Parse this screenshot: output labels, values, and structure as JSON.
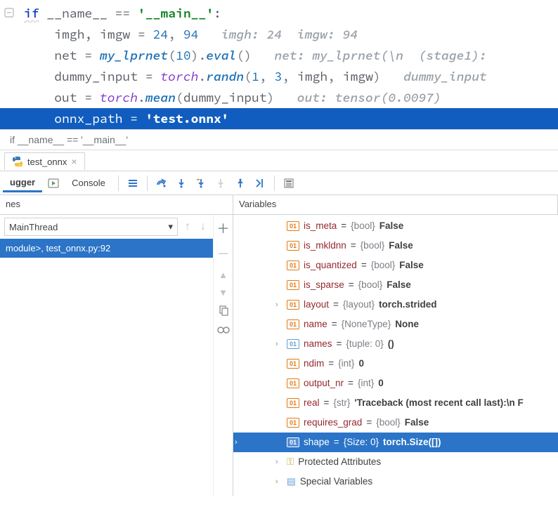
{
  "editor": {
    "lines": {
      "l1_kw": "if",
      "l1_rest": " __name__ == ",
      "l1_str": "'__main__'",
      "l1_colon": ":",
      "l2_vars": "imgh, imgw",
      "l2_eq": " = ",
      "l2_n1": "24",
      "l2_c": ", ",
      "l2_n2": "94",
      "l2_hint": "   imgh: 24  imgw: 94",
      "l3_v": "net",
      "l3_eq": " = ",
      "l3_fn1": "my_lprnet",
      "l3_p1": "(",
      "l3_n": "10",
      "l3_p2": ").",
      "l3_fn2": "eval",
      "l3_p3": "()",
      "l3_hint": "   net: my_lprnet(\\n  (stage1):",
      "l4_v": "dummy_input",
      "l4_eq": " = ",
      "l4_obj": "torch",
      "l4_dot": ".",
      "l4_fn": "randn",
      "l4_p1": "(",
      "l4_n1": "1",
      "l4_c1": ", ",
      "l4_n2": "3",
      "l4_c2": ", ",
      "l4_a1": "imgh",
      "l4_c3": ", ",
      "l4_a2": "imgw",
      "l4_p2": ")",
      "l4_hint": "   dummy_input",
      "l5_v": "out",
      "l5_eq": " = ",
      "l5_obj": "torch",
      "l5_dot": ".",
      "l5_fn": "mean",
      "l5_p1": "(",
      "l5_a": "dummy_input",
      "l5_p2": ")",
      "l5_hint": "   out: tensor(0.0097)",
      "l6_v": "onnx_path",
      "l6_eq": " = ",
      "l6_str": "'test.onnx'"
    }
  },
  "breadcrumb": "if __name__ == '__main__'",
  "tab": {
    "title": "test_onnx",
    "close": "×"
  },
  "toolbar": {
    "debugger": "ugger",
    "console": "Console"
  },
  "panes": {
    "left": "nes",
    "right": "Variables"
  },
  "thread": {
    "selected": "MainThread"
  },
  "frame": "module>, test_onnx.py:92",
  "tree_badge": "01",
  "vars": [
    {
      "name": "is_meta",
      "type": "{bool}",
      "val": "False"
    },
    {
      "name": "is_mkldnn",
      "type": "{bool}",
      "val": "False"
    },
    {
      "name": "is_quantized",
      "type": "{bool}",
      "val": "False"
    },
    {
      "name": "is_sparse",
      "type": "{bool}",
      "val": "False"
    },
    {
      "name": "layout",
      "type": "{layout}",
      "val": "torch.strided",
      "exp": true,
      "icon": "eq"
    },
    {
      "name": "name",
      "type": "{NoneType}",
      "val": "None"
    },
    {
      "name": "names",
      "type": "{tuple: 0}",
      "val": "()",
      "exp": true,
      "icon": "tp"
    },
    {
      "name": "ndim",
      "type": "{int}",
      "val": "0"
    },
    {
      "name": "output_nr",
      "type": "{int}",
      "val": "0"
    },
    {
      "name": "real",
      "type": "{str}",
      "val": "'Traceback (most recent call last):\\n  F"
    },
    {
      "name": "requires_grad",
      "type": "{bool}",
      "val": "False"
    },
    {
      "name": "shape",
      "type": "{Size: 0}",
      "val": "torch.Size([])",
      "exp": true,
      "icon": "eq",
      "sel": true
    },
    {
      "name": "Protected Attributes",
      "special": "key",
      "exp": true
    },
    {
      "name": "Special Variables",
      "special": "bars",
      "exp": true
    }
  ]
}
